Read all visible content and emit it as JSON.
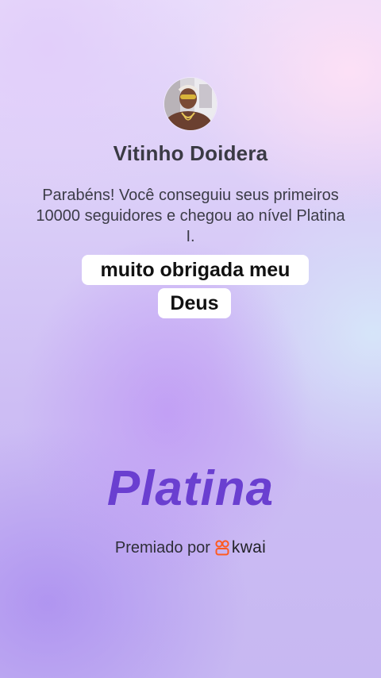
{
  "profile": {
    "name": "Vitinho Doidera"
  },
  "congrats": {
    "message": "Parabéns! Você conseguiu seus primeiros 10000 seguidores e chegou ao nível Platina I."
  },
  "caption": {
    "line_1": "muito obrigada meu",
    "line_2": "Deus"
  },
  "tier": {
    "title": "Platina",
    "color": "#6a3fd0"
  },
  "awarded": {
    "prefix": "Premiado por",
    "brand": "kwai",
    "brand_icon": "kwai-logo-icon",
    "brand_color": "#ff5a1f"
  }
}
